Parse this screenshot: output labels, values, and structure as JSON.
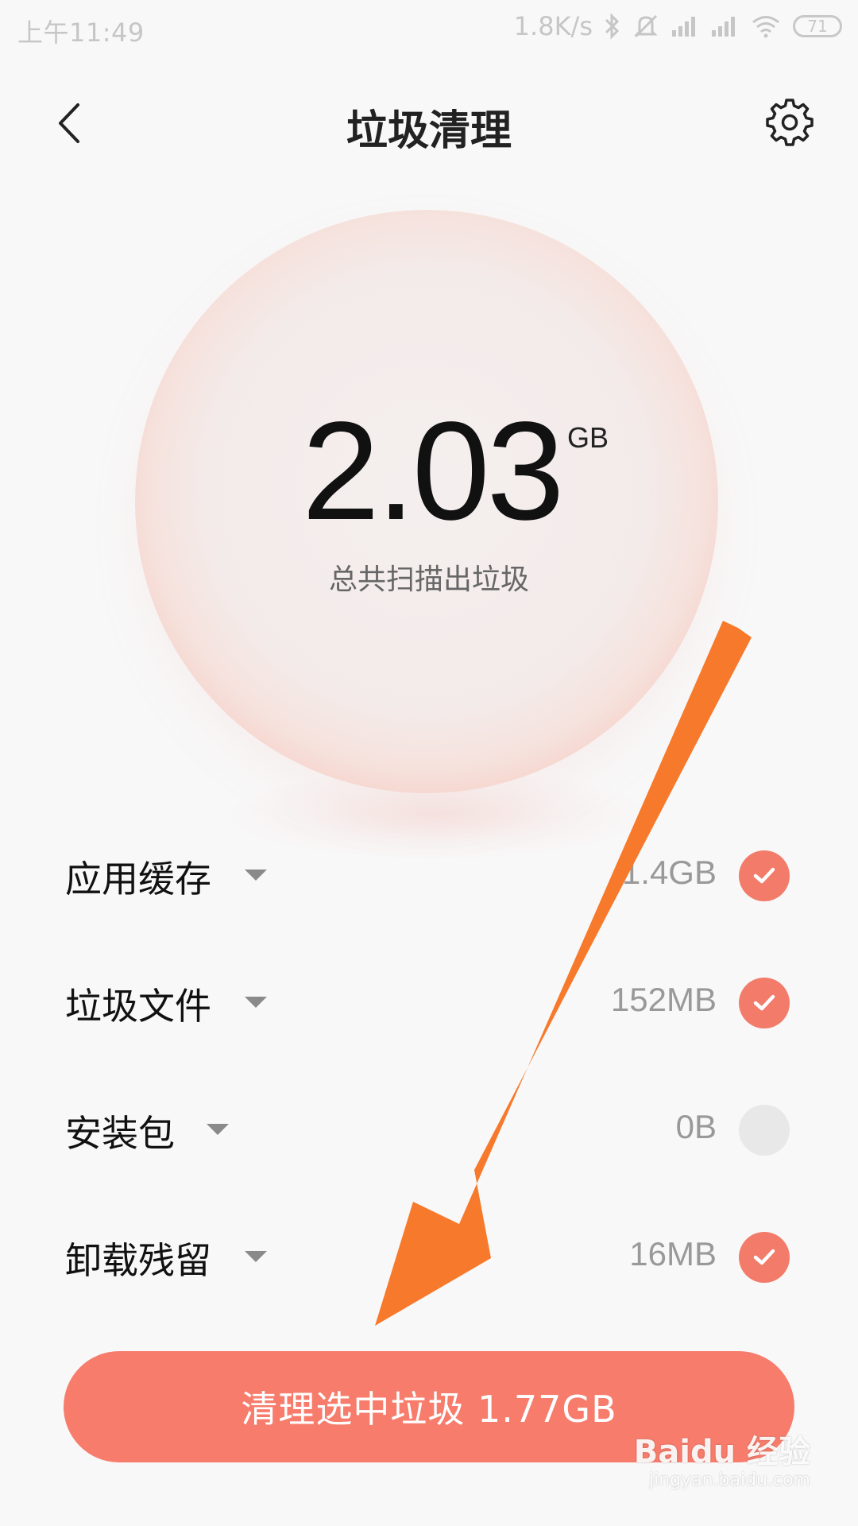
{
  "status_bar": {
    "time": "上午11:49",
    "net_speed": "1.8K/s",
    "battery": "71",
    "icons": [
      "bluetooth-icon",
      "mute-icon",
      "signal-icon",
      "signal-icon",
      "wifi-icon",
      "battery-icon"
    ]
  },
  "header": {
    "title": "垃圾清理",
    "back_icon": "chevron-left-icon",
    "settings_icon": "gear-icon"
  },
  "scan": {
    "value": "2.03",
    "unit": "GB",
    "caption": "总共扫描出垃圾"
  },
  "items": [
    {
      "label": "应用缓存",
      "size": "1.4GB",
      "checked": true
    },
    {
      "label": "垃圾文件",
      "size": "152MB",
      "checked": true
    },
    {
      "label": "安装包",
      "size": "0B",
      "checked": false
    },
    {
      "label": "卸载残留",
      "size": "16MB",
      "checked": true
    }
  ],
  "clean_button": {
    "label": "清理选中垃圾 1.77GB"
  },
  "watermark": {
    "logo": "Baidu 经验",
    "url": "jingyan.baidu.com"
  },
  "colors": {
    "accent": "#f77c6c",
    "check": "#f27b6a",
    "annotation_arrow": "#f7792b",
    "unchecked": "#e8e8e8"
  }
}
